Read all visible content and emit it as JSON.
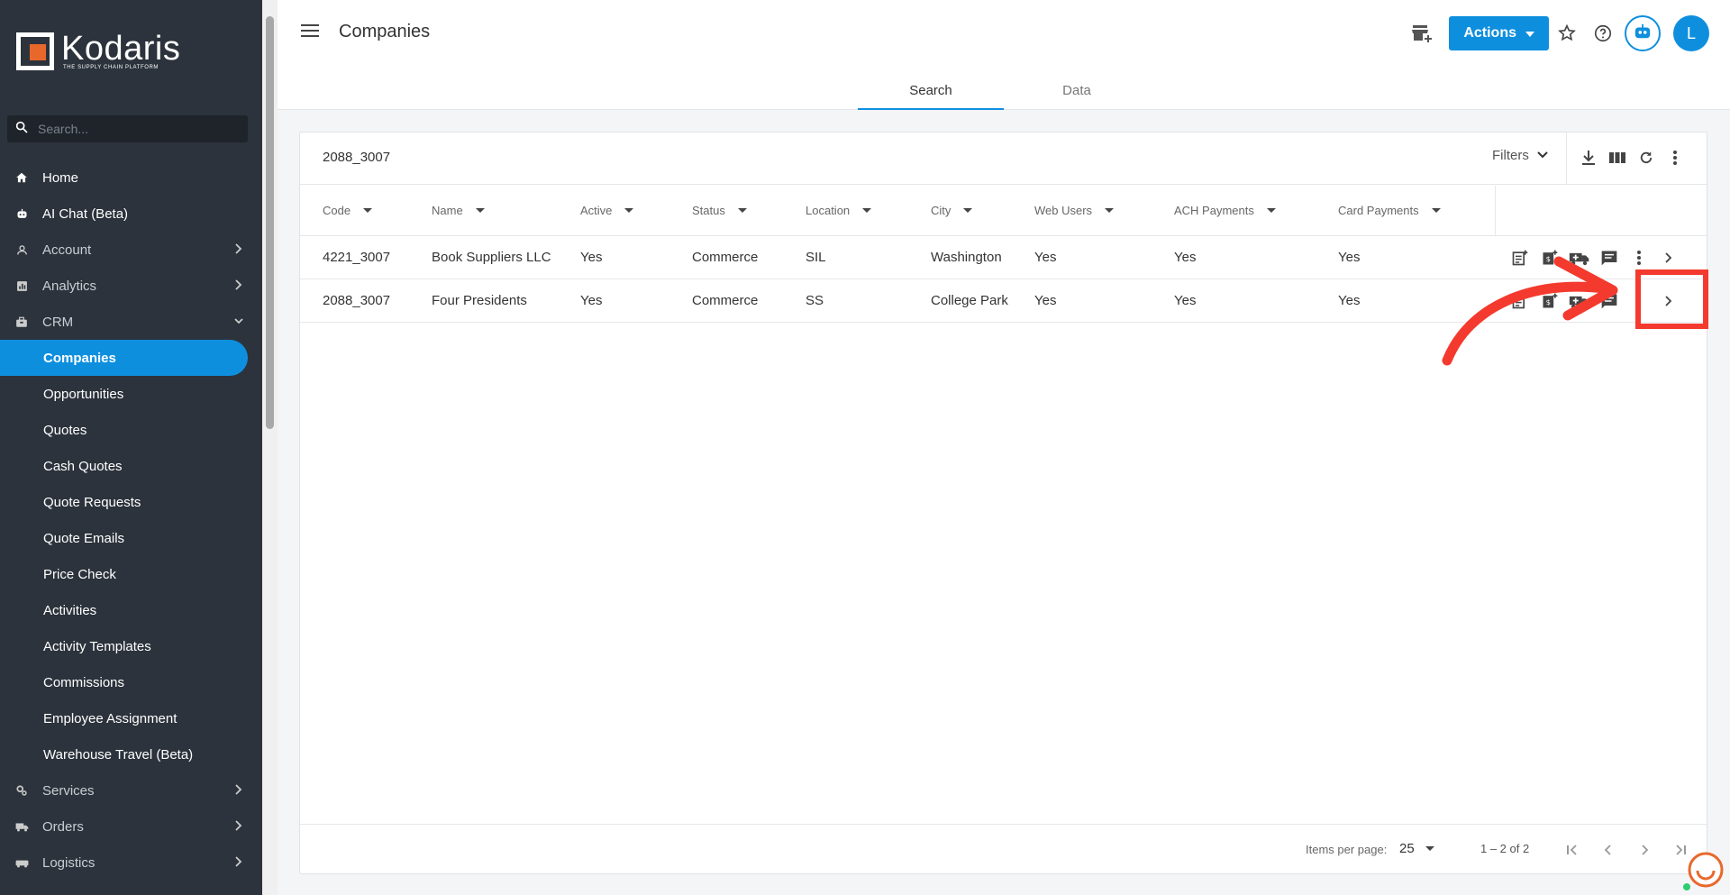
{
  "sidebar": {
    "logo": {
      "name": "Kodaris",
      "tagline": "THE SUPPLY CHAIN PLATFORM"
    },
    "search": {
      "placeholder": "Search..."
    },
    "items": [
      {
        "label": "Home",
        "icon": "home-icon",
        "expandable": false
      },
      {
        "label": "AI Chat (Beta)",
        "icon": "robot-icon",
        "expandable": false
      },
      {
        "label": "Account",
        "icon": "person-icon",
        "expandable": true
      },
      {
        "label": "Analytics",
        "icon": "chart-icon",
        "expandable": true
      },
      {
        "label": "CRM",
        "icon": "briefcase-icon",
        "expandable": true,
        "expanded": true
      }
    ],
    "crm_sub": [
      "Companies",
      "Opportunities",
      "Quotes",
      "Cash Quotes",
      "Quote Requests",
      "Quote Emails",
      "Price Check",
      "Activities",
      "Activity Templates",
      "Commissions",
      "Employee Assignment",
      "Warehouse Travel (Beta)"
    ],
    "crm_active": "Companies",
    "bottom_items": [
      {
        "label": "Services",
        "icon": "services-icon"
      },
      {
        "label": "Orders",
        "icon": "truck-icon"
      },
      {
        "label": "Logistics",
        "icon": "logistics-icon"
      }
    ]
  },
  "header": {
    "title": "Companies",
    "actions_label": "Actions",
    "avatar_initial": "L",
    "tabs": [
      {
        "label": "Search",
        "active": true
      },
      {
        "label": "Data",
        "active": false
      }
    ]
  },
  "card": {
    "query": "2088_3007",
    "filters_label": "Filters",
    "columns": [
      "Code",
      "Name",
      "Active",
      "Status",
      "Location",
      "City",
      "Web Users",
      "ACH Payments",
      "Card Payments"
    ],
    "rows": [
      [
        "4221_3007",
        "Book Suppliers LLC",
        "Yes",
        "Commerce",
        "SIL",
        "Washington",
        "Yes",
        "Yes",
        "Yes"
      ],
      [
        "2088_3007",
        "Four Presidents",
        "Yes",
        "Commerce",
        "SS",
        "College Park",
        "Yes",
        "Yes",
        "Yes"
      ]
    ],
    "footer": {
      "items_per_page_label": "Items per page:",
      "items_per_page": "25",
      "range": "1 – 2 of 2"
    }
  },
  "colors": {
    "sidebar_bg": "#2c333c",
    "accent": "#0e8fde",
    "annotation": "#f43a2e"
  }
}
